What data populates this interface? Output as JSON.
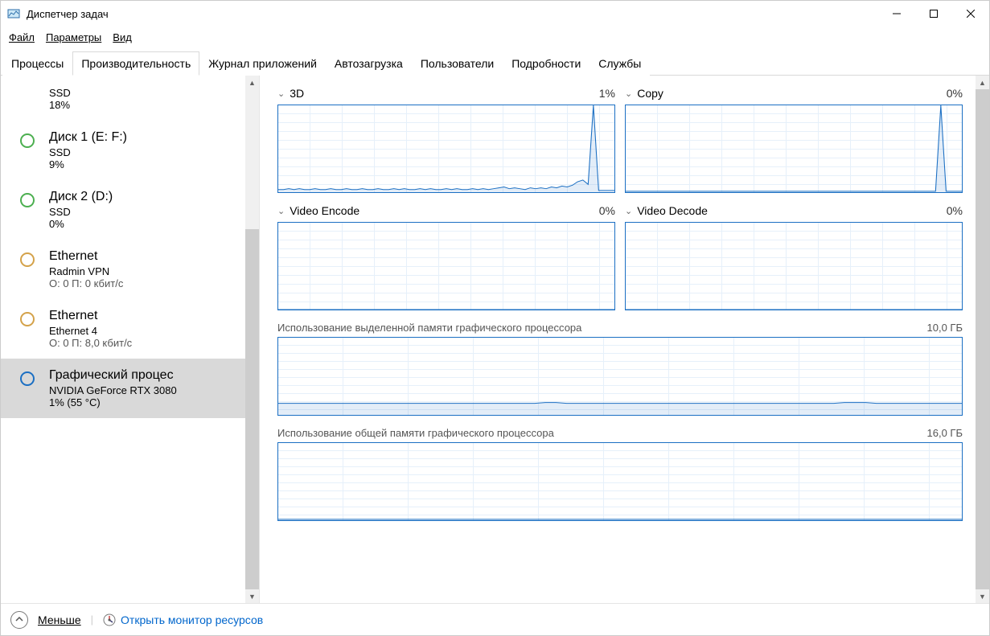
{
  "window": {
    "title": "Диспетчер задач"
  },
  "menu": {
    "file": "Файл",
    "options": "Параметры",
    "view": "Вид"
  },
  "tabs": {
    "processes": "Процессы",
    "performance": "Производительность",
    "app_history": "Журнал приложений",
    "startup": "Автозагрузка",
    "users": "Пользователи",
    "details": "Подробности",
    "services": "Службы"
  },
  "sidebar": {
    "items": [
      {
        "title": "",
        "sub": "SSD",
        "meta": "18%",
        "icon_color": "",
        "selected": false,
        "partial": true
      },
      {
        "title": "Диск 1 (E: F:)",
        "sub": "SSD",
        "meta": "9%",
        "icon_color": "#4caf50",
        "selected": false
      },
      {
        "title": "Диск 2 (D:)",
        "sub": "SSD",
        "meta": "0%",
        "icon_color": "#4caf50",
        "selected": false
      },
      {
        "title": "Ethernet",
        "sub": "Radmin VPN",
        "meta": "О: 0 П: 0 кбит/с",
        "icon_color": "#d4a24a",
        "selected": false
      },
      {
        "title": "Ethernet",
        "sub": "Ethernet 4",
        "meta": "О: 0 П: 8,0 кбит/с",
        "icon_color": "#d4a24a",
        "selected": false
      },
      {
        "title": "Графический процес",
        "sub": "NVIDIA GeForce RTX 3080",
        "meta": "1% (55 °C)",
        "icon_color": "#1b6fc3",
        "selected": true
      }
    ]
  },
  "charts": {
    "small": [
      {
        "label": "3D",
        "value": "1%"
      },
      {
        "label": "Copy",
        "value": "0%"
      },
      {
        "label": "Video Encode",
        "value": "0%"
      },
      {
        "label": "Video Decode",
        "value": "0%"
      }
    ],
    "wide": [
      {
        "label": "Использование выделенной памяти графического процессора",
        "value": "10,0 ГБ"
      },
      {
        "label": "Использование общей памяти графического процессора",
        "value": "16,0 ГБ"
      }
    ]
  },
  "footer": {
    "less": "Меньше",
    "open_monitor": "Открыть монитор ресурсов"
  },
  "chart_data": [
    {
      "type": "line",
      "title": "3D",
      "ylim": [
        0,
        100
      ],
      "values_pct": [
        3,
        3,
        4,
        3,
        4,
        3,
        3,
        4,
        3,
        3,
        4,
        3,
        3,
        4,
        3,
        3,
        4,
        3,
        3,
        4,
        3,
        3,
        4,
        3,
        4,
        3,
        3,
        4,
        3,
        4,
        3,
        3,
        4,
        3,
        4,
        3,
        3,
        4,
        3,
        4,
        3,
        4,
        5,
        6,
        4,
        5,
        4,
        3,
        5,
        4,
        5,
        4,
        6,
        5,
        7,
        6,
        8,
        12,
        14,
        9,
        100,
        2,
        2,
        2,
        2
      ]
    },
    {
      "type": "line",
      "title": "Copy",
      "ylim": [
        0,
        100
      ],
      "values_pct": [
        1,
        1,
        1,
        1,
        1,
        1,
        1,
        1,
        1,
        1,
        1,
        1,
        1,
        1,
        1,
        1,
        1,
        1,
        1,
        1,
        1,
        1,
        1,
        1,
        1,
        1,
        1,
        1,
        1,
        1,
        1,
        1,
        1,
        1,
        1,
        1,
        1,
        1,
        1,
        1,
        1,
        1,
        1,
        1,
        1,
        1,
        1,
        1,
        1,
        1,
        1,
        1,
        1,
        1,
        1,
        1,
        1,
        1,
        1,
        1,
        100,
        1,
        1,
        1,
        1
      ]
    },
    {
      "type": "line",
      "title": "Video Encode",
      "ylim": [
        0,
        100
      ],
      "values_pct": [
        0,
        0,
        0,
        0,
        0,
        0,
        0,
        0,
        0,
        0,
        0,
        0,
        0,
        0,
        0,
        0,
        0,
        0,
        0,
        0,
        0,
        0,
        0,
        0,
        0,
        0,
        0,
        0,
        0,
        0,
        0,
        0,
        0,
        0,
        0,
        0,
        0,
        0,
        0,
        0,
        0,
        0,
        0,
        0,
        0,
        0,
        0,
        0,
        0,
        0,
        0,
        0,
        0,
        0,
        0,
        0,
        0,
        0,
        0,
        0,
        0,
        0,
        0,
        0,
        0
      ]
    },
    {
      "type": "line",
      "title": "Video Decode",
      "ylim": [
        0,
        100
      ],
      "values_pct": [
        0,
        0,
        0,
        0,
        0,
        0,
        0,
        0,
        0,
        0,
        0,
        0,
        0,
        0,
        0,
        0,
        0,
        0,
        0,
        0,
        0,
        0,
        0,
        0,
        0,
        0,
        0,
        0,
        0,
        0,
        0,
        0,
        0,
        0,
        0,
        0,
        0,
        0,
        0,
        0,
        0,
        0,
        0,
        0,
        0,
        0,
        0,
        0,
        0,
        0,
        0,
        0,
        0,
        0,
        0,
        0,
        0,
        0,
        0,
        0,
        0,
        0,
        0,
        0,
        0
      ]
    },
    {
      "type": "line",
      "title": "Использование выделенной памяти графического процессора",
      "ylim_gb": [
        0,
        10
      ],
      "values_gb": [
        1.5,
        1.5,
        1.5,
        1.5,
        1.5,
        1.5,
        1.5,
        1.5,
        1.5,
        1.5,
        1.5,
        1.5,
        1.5,
        1.5,
        1.5,
        1.5,
        1.5,
        1.5,
        1.5,
        1.5,
        1.5,
        1.5,
        1.5,
        1.5,
        1.5,
        1.6,
        1.6,
        1.5,
        1.5,
        1.5,
        1.5,
        1.5,
        1.5,
        1.5,
        1.5,
        1.5,
        1.5,
        1.5,
        1.5,
        1.5,
        1.5,
        1.5,
        1.5,
        1.5,
        1.5,
        1.5,
        1.5,
        1.5,
        1.5,
        1.5,
        1.5,
        1.5,
        1.5,
        1.6,
        1.6,
        1.6,
        1.5,
        1.5,
        1.5,
        1.5,
        1.5,
        1.5,
        1.5,
        1.5,
        1.5
      ]
    },
    {
      "type": "line",
      "title": "Использование общей памяти графического процессора",
      "ylim_gb": [
        0,
        16
      ],
      "values_gb": [
        0.2,
        0.2,
        0.2,
        0.2,
        0.2,
        0.2,
        0.2,
        0.2,
        0.2,
        0.2,
        0.2,
        0.2,
        0.2,
        0.2,
        0.2,
        0.2,
        0.2,
        0.2,
        0.2,
        0.2,
        0.2,
        0.2,
        0.2,
        0.2,
        0.2,
        0.2,
        0.2,
        0.2,
        0.2,
        0.2,
        0.2,
        0.2,
        0.2,
        0.2,
        0.2,
        0.2,
        0.2,
        0.2,
        0.2,
        0.2,
        0.2,
        0.2,
        0.2,
        0.2,
        0.2,
        0.2,
        0.2,
        0.2,
        0.2,
        0.2,
        0.2,
        0.2,
        0.2,
        0.2,
        0.2,
        0.2,
        0.2,
        0.2,
        0.2,
        0.2,
        0.2,
        0.2,
        0.2,
        0.2,
        0.2
      ]
    }
  ]
}
